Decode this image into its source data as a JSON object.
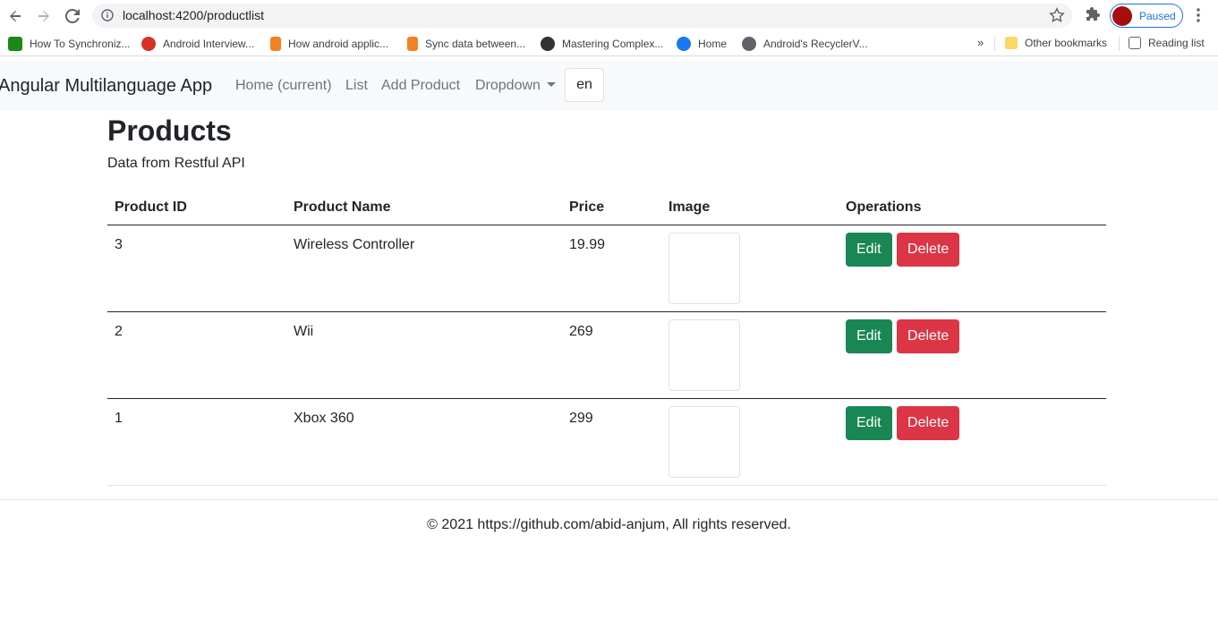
{
  "browser": {
    "url": "localhost:4200/productlist",
    "profile_status": "Paused",
    "bookmarks": [
      {
        "label": "How To Synchroniz...",
        "icon": "medium-icon",
        "color": "#1a8917"
      },
      {
        "label": "Android Interview...",
        "icon": "red-logo-icon",
        "color": "#d93025"
      },
      {
        "label": "How android applic...",
        "icon": "stackoverflow-icon",
        "color": "#f48024"
      },
      {
        "label": "Sync data between...",
        "icon": "stackoverflow-icon",
        "color": "#f48024"
      },
      {
        "label": "Mastering Complex...",
        "icon": "dark-circle-icon",
        "color": "#333333"
      },
      {
        "label": "Home",
        "icon": "facebook-icon",
        "color": "#1877f2"
      },
      {
        "label": "Android's RecyclerV...",
        "icon": "globe-icon",
        "color": "#5f6368"
      }
    ],
    "more_bookmarks": "»",
    "other_bookmarks": "Other bookmarks",
    "reading_list": "Reading list"
  },
  "app_nav": {
    "brand": "Angular Multilanguage App",
    "links": [
      "Home (current)",
      "List",
      "Add Product",
      "Dropdown"
    ],
    "language": "en"
  },
  "page": {
    "title": "Products",
    "subtitle": "Data from Restful API"
  },
  "table": {
    "headers": [
      "Product ID",
      "Product Name",
      "Price",
      "Image",
      "Operations"
    ],
    "rows": [
      {
        "id": "3",
        "name": "Wireless Controller",
        "price": "19.99"
      },
      {
        "id": "2",
        "name": "Wii",
        "price": "269"
      },
      {
        "id": "1",
        "name": "Xbox 360",
        "price": "299"
      }
    ],
    "edit_label": "Edit",
    "delete_label": "Delete"
  },
  "footer": {
    "text": "© 2021 https://github.com/abid-anjum, All rights reserved."
  },
  "colors": {
    "edit": "#198754",
    "delete": "#dc3545",
    "navbar_bg": "#f8f9fa"
  }
}
